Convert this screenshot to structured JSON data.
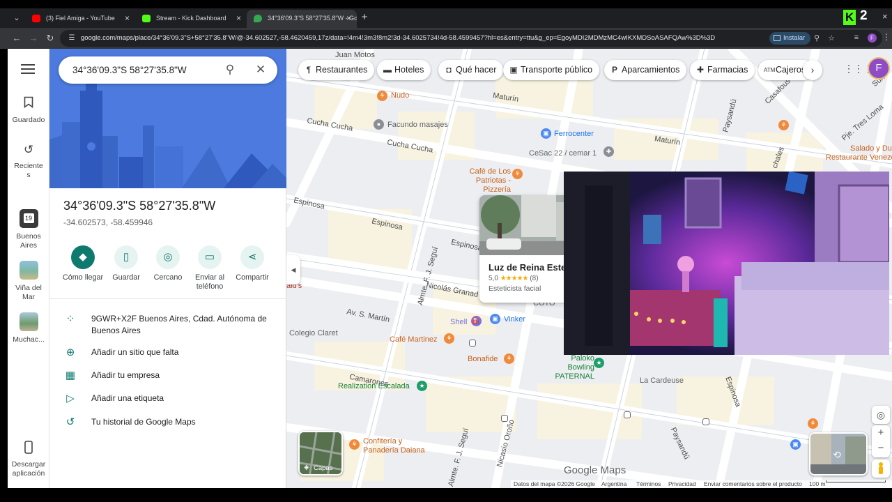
{
  "browser": {
    "tabs": [
      {
        "title": "(3) Fiel Amiga - YouTube",
        "color": "#ff0000"
      },
      {
        "title": "Stream - Kick Dashboard",
        "color": "#53fc18"
      },
      {
        "title": "34°36'09.3\"S 58°27'35.8\"W - Go",
        "color": "#34a853"
      }
    ],
    "tab_close": "×",
    "new_tab": "+",
    "kick_letter": "K",
    "kick_number": "2",
    "window_close": "×",
    "url": "google.com/maps/place/34°36'09.3\"S+58°27'35.8\"W/@-34.602527,-58.4620459,17z/data=!4m4!3m3!8m2!3d-34.6025734!4d-58.4599457?hl=es&entry=ttu&g_ep=EgoyMDI2MDMzMC4wIKXMDSoASAFQAw%3D%3D",
    "install_label": "Instalar",
    "profile_letter": "F"
  },
  "rail": {
    "saved_label": "Guardado",
    "recents_label": "Recientes",
    "recent_places": [
      {
        "label": "Buenos Aires",
        "badge": "19"
      },
      {
        "label": "Viña del Mar"
      },
      {
        "label": "Muchac..."
      }
    ],
    "download_label": "Descargar aplicación"
  },
  "panel": {
    "search_value": "34°36'09.3\"S 58°27'35.8\"W",
    "title": "34°36'09.3\"S 58°27'35.8\"W",
    "decimal_coords": "-34.602573, -58.459946",
    "actions": [
      {
        "label": "Cómo llegar",
        "icon": "directions-icon"
      },
      {
        "label": "Guardar",
        "icon": "bookmark-icon"
      },
      {
        "label": "Cercano",
        "icon": "nearby-icon"
      },
      {
        "label": "Enviar al teléfono",
        "icon": "send-to-phone-icon"
      },
      {
        "label": "Compartir",
        "icon": "share-icon"
      }
    ],
    "info_rows": [
      {
        "text": "9GWR+X2F Buenos Aires, Cdad. Autónoma de Buenos Aires",
        "icon": "plus-code-icon"
      },
      {
        "text": "Añadir un sitio que falta",
        "icon": "add-place-icon"
      },
      {
        "text": "Añadir tu empresa",
        "icon": "add-business-icon"
      },
      {
        "text": "Añadir una etiqueta",
        "icon": "label-icon"
      },
      {
        "text": "Tu historial de Google Maps",
        "icon": "history-icon"
      }
    ],
    "accent_color": "#0e7a6e"
  },
  "map": {
    "chips": [
      {
        "label": "Restaurantes",
        "icon": "fork-knife-icon"
      },
      {
        "label": "Hoteles",
        "icon": "bed-icon"
      },
      {
        "label": "Qué hacer",
        "icon": "camera-icon"
      },
      {
        "label": "Transporte público",
        "icon": "train-icon"
      },
      {
        "label": "Aparcamientos",
        "icon": "parking-icon"
      },
      {
        "label": "Farmacias",
        "icon": "pharmacy-icon"
      },
      {
        "label": "Cajeros",
        "icon": "atm-icon"
      }
    ],
    "avatar_letter": "F",
    "streets": {
      "juan_motos": "Juan Motos",
      "maturin_1": "Maturín",
      "maturin_2": "Maturín",
      "cucha_cucha_1": "Cucha Cucha",
      "cucha_cucha_2": "Cucha Cucha",
      "espinosa_1": "Espinosa",
      "espinosa_2": "Espinosa",
      "espinosa_3": "Espinosa",
      "espinosa_4": "Espinosa",
      "av_san_martin": "Av. S. Martín",
      "nicolas_granada": "Nicolás Granad",
      "camarones": "Camarones",
      "almte_segui_1": "Almte. F. J. Seguí",
      "almte_segui_2": "Almte. F. J. Seguí",
      "nicasio_orono": "Nicasio Oroño",
      "paysandu_1": "Paysandú",
      "paysandu_2": "Paysandú",
      "casafousth": "Casafous",
      "pje_tres_lomas": "Pje. Tres Loma",
      "chales": "chales",
      "sun": "Sun",
      "la_cardeuse": "La Cardeuse",
      "cotos": "COTO",
      "aids": "ald's",
      "cesac": "CeSac 22 / cemar 1"
    },
    "pois": [
      {
        "name": "Nudo",
        "kind": "restaurant"
      },
      {
        "name": "Facundo masajes",
        "kind": "generic"
      },
      {
        "name": "Ferrocenter",
        "kind": "shop"
      },
      {
        "name": "Café de Los Patriotas - Pizzería",
        "kind": "restaurant"
      },
      {
        "name": "Salado y Du",
        "kind": "restaurant"
      },
      {
        "name": "Restaurante Venezola",
        "kind": "restaurant"
      },
      {
        "name": "Shell",
        "kind": "gas"
      },
      {
        "name": "Vinker",
        "kind": "shop"
      },
      {
        "name": "Colegio Claret",
        "kind": "school"
      },
      {
        "name": "Café Martinez",
        "kind": "restaurant"
      },
      {
        "name": "Bonafide",
        "kind": "restaurant"
      },
      {
        "name": "Paloko Bowling PATERNAL",
        "kind": "activity"
      },
      {
        "name": "Realization Escalada",
        "kind": "activity"
      },
      {
        "name": "Confitería y Panadería Daiana",
        "kind": "restaurant"
      }
    ],
    "place_card": {
      "name": "Luz de Reina Este",
      "rating": "5,0",
      "stars": "★★★★★",
      "reviews": "(8)",
      "type": "Esteticista facial"
    },
    "layers_label": "Capas",
    "logo_text": "Google Maps",
    "footer": {
      "data": "Datos del mapa ©2026 Google",
      "country": "Argentina",
      "terms": "Términos",
      "privacy": "Privacidad",
      "feedback": "Enviar comentarios sobre el producto",
      "scale": "100 m"
    }
  }
}
